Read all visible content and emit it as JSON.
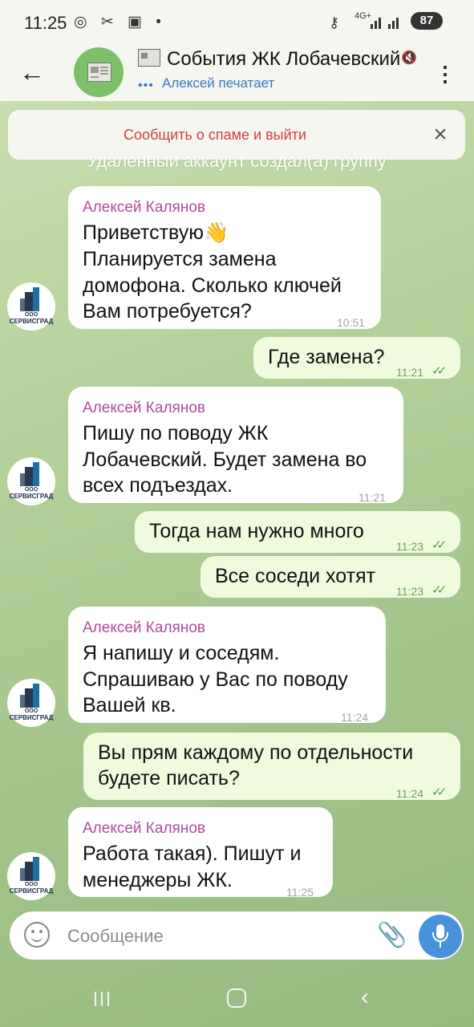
{
  "status_bar": {
    "time": "11:25",
    "left_icons": "◎ ✂ ▣ •",
    "network": "4G+",
    "battery": "87"
  },
  "header": {
    "back_icon": "←",
    "title": "События ЖК Лобачевский",
    "subtitle": "Алексей печатает",
    "typing_dots": "•••",
    "mute_icon": "🔇",
    "more_icon": "⋮"
  },
  "spam_bar": {
    "link": "Сообщить о спаме и выйти",
    "close_icon": "×"
  },
  "service_message": "Удаленный аккаунт создал(а) группу",
  "avatar": {
    "ooo": "ООО",
    "brand": "СЕРВИСГРАД"
  },
  "messages": [
    {
      "direction": "in",
      "sender": "Алексей Калянов",
      "lines": [
        "Приветствую👋",
        "Планируется замена",
        "домофона. Сколько ключей",
        "Вам потребуется?"
      ],
      "time": "10:51"
    },
    {
      "direction": "out",
      "lines": [
        "Где замена?"
      ],
      "time": "11:21",
      "status": "read"
    },
    {
      "direction": "in",
      "sender": "Алексей Калянов",
      "lines": [
        "Пишу по поводу ЖК",
        "Лобачевский. Будет замена во",
        "всех подъездах."
      ],
      "time": "11:21"
    },
    {
      "direction": "out",
      "lines": [
        "Тогда нам нужно много"
      ],
      "time": "11:23",
      "status": "read"
    },
    {
      "direction": "out",
      "lines": [
        "Все соседи хотят"
      ],
      "time": "11:23",
      "status": "read"
    },
    {
      "direction": "in",
      "sender": "Алексей Калянов",
      "lines": [
        "Я напишу и соседям.",
        "Спрашиваю у Вас по поводу",
        "Вашей кв."
      ],
      "time": "11:24"
    },
    {
      "direction": "out",
      "lines": [
        "Вы прям каждому по отдельности",
        "будете писать?"
      ],
      "time": "11:24",
      "status": "read"
    },
    {
      "direction": "in",
      "sender": "Алексей Калянов",
      "lines": [
        "Работа такая). Пишут и",
        "менеджеры ЖК."
      ],
      "time": "11:25"
    }
  ],
  "read_checks": "✓✓",
  "composer": {
    "placeholder": "Сообщение",
    "attach_icon": "📎"
  },
  "nav": {
    "back_icon": "‹"
  },
  "colors": {
    "sender": "#b14b9b",
    "outgoing_bubble": "#f0fbdd",
    "accent": "#4792da",
    "spam": "#cf4049"
  }
}
